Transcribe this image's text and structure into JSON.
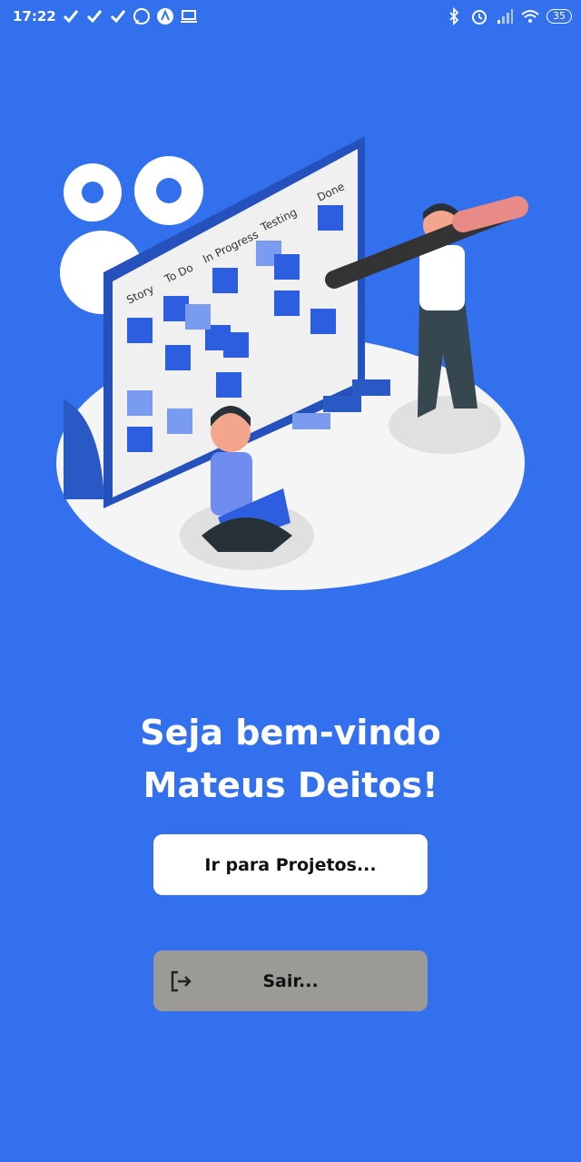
{
  "status_bar": {
    "time": "17:22",
    "battery": "35",
    "left_icons": [
      "check-icon",
      "check-icon",
      "check-icon",
      "whatsapp-icon",
      "app-icon",
      "laptop-icon"
    ],
    "right_icons": [
      "bluetooth-icon",
      "alarm-icon",
      "signal-icon",
      "wifi-icon",
      "battery-icon"
    ]
  },
  "illustration": {
    "board_columns": [
      "Story",
      "To Do",
      "In Progress",
      "Testing",
      "Done"
    ]
  },
  "welcome": {
    "line1": "Seja bem-vindo",
    "line2": "Mateus Deitos!"
  },
  "buttons": {
    "projects_label": "Ir para Projetos...",
    "exit_label": "Sair...",
    "exit_icon": "logout-icon"
  },
  "colors": {
    "background": "#3370ed",
    "projects_button": "#ffffff",
    "exit_button": "#9c9a96"
  }
}
